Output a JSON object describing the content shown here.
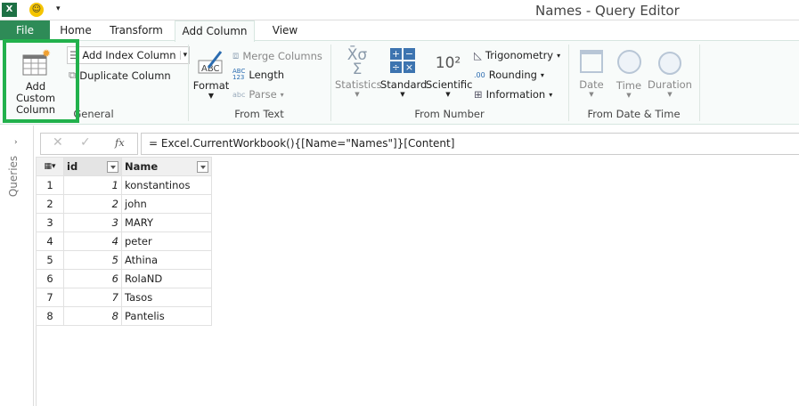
{
  "window": {
    "title": "Names - Query Editor"
  },
  "tabs": [
    {
      "label": "File"
    },
    {
      "label": "Home"
    },
    {
      "label": "Transform"
    },
    {
      "label": "Add Column",
      "active": true
    },
    {
      "label": "View"
    }
  ],
  "ribbon": {
    "general": {
      "label": "General",
      "add_custom_column": "Add Custom Column",
      "add_index_column": "Add Index Column",
      "duplicate_column": "Duplicate Column"
    },
    "from_text": {
      "label": "From Text",
      "format": "Format",
      "merge_columns": "Merge Columns",
      "length": "Length",
      "parse": "Parse"
    },
    "from_number": {
      "label": "From Number",
      "statistics": "Statistics",
      "standard": "Standard",
      "scientific": "Scientific",
      "scientific_icon": "10²",
      "trigonometry": "Trigonometry",
      "rounding": "Rounding",
      "information": "Information"
    },
    "from_datetime": {
      "label": "From Date & Time",
      "date": "Date",
      "time": "Time",
      "duration": "Duration"
    }
  },
  "highlight_color": "#22b14c",
  "queries_pane": {
    "label": "Queries"
  },
  "formula_bar": {
    "fx": "fx",
    "formula": "= Excel.CurrentWorkbook(){[Name=\"Names\"]}[Content]"
  },
  "table": {
    "columns": [
      "id",
      "Name"
    ],
    "rows": [
      {
        "n": "1",
        "id": "1",
        "name": "konstantinos"
      },
      {
        "n": "2",
        "id": "2",
        "name": "john"
      },
      {
        "n": "3",
        "id": "3",
        "name": "MARY"
      },
      {
        "n": "4",
        "id": "4",
        "name": "peter"
      },
      {
        "n": "5",
        "id": "5",
        "name": "Athina"
      },
      {
        "n": "6",
        "id": "6",
        "name": "RolaND"
      },
      {
        "n": "7",
        "id": "7",
        "name": "Tasos"
      },
      {
        "n": "8",
        "id": "8",
        "name": "Pantelis"
      }
    ]
  }
}
